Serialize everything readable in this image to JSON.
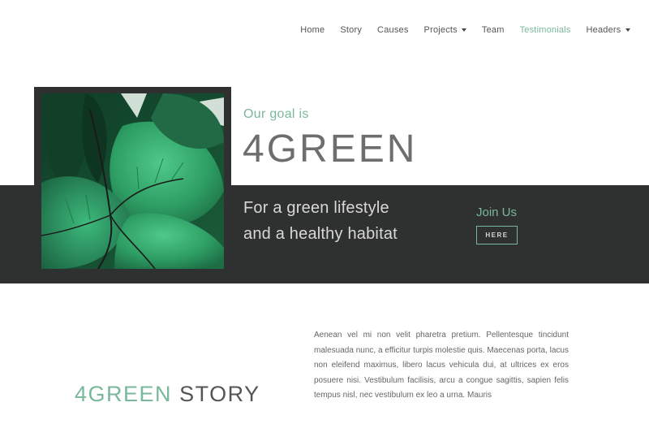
{
  "nav": {
    "items": [
      {
        "label": "Home",
        "dropdown": false,
        "active": false
      },
      {
        "label": "Story",
        "dropdown": false,
        "active": false
      },
      {
        "label": "Causes",
        "dropdown": false,
        "active": false
      },
      {
        "label": "Projects",
        "dropdown": true,
        "active": false
      },
      {
        "label": "Team",
        "dropdown": false,
        "active": false
      },
      {
        "label": "Testimonials",
        "dropdown": false,
        "active": true
      },
      {
        "label": "Headers",
        "dropdown": true,
        "active": false
      }
    ]
  },
  "hero": {
    "goal_label": "Our goal is",
    "brand": "4GREEN",
    "tagline_line1": "For a green lifestyle",
    "tagline_line2": "and a healthy habitat",
    "join_label": "Join Us",
    "cta_label": "HERE",
    "image_subject": "green leaves"
  },
  "story": {
    "title_accent": "4GREEN",
    "title_rest": "STORY",
    "body": "Aenean vel mi non velit pharetra pretium. Pellentesque tincidunt malesuada nunc, a efficitur turpis molestie quis. Maecenas porta, lacus non eleifend maximus, libero lacus vehicula dui, at ultrices ex eros posuere nisi. Vestibulum facilisis, arcu a congue sagittis, sapien felis tempus nisl, nec vestibulum ex leo a urna. Mauris"
  },
  "colors": {
    "accent": "#7ab89a",
    "dark_band": "#2f3030",
    "brand_text": "#6e6e6e"
  }
}
